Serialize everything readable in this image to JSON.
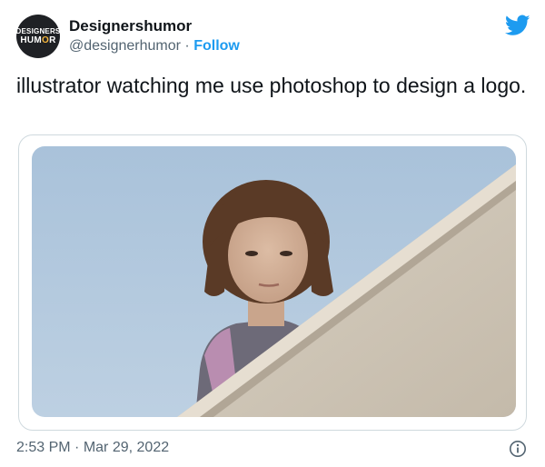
{
  "account": {
    "display_name": "Designershumor",
    "handle": "@designerhumor",
    "separator": "·",
    "follow_label": "Follow",
    "avatar_line1": "DESIGNERS",
    "avatar_line2_a": "HUM",
    "avatar_line2_o": "O",
    "avatar_line2_b": "R"
  },
  "tweet": {
    "text": "illustrator watching me use photoshop to design a logo.",
    "time": "2:53 PM",
    "separator": "·",
    "date": "Mar 29, 2022"
  },
  "icons": {
    "brand": "twitter-bird-icon",
    "info": "info-icon"
  },
  "colors": {
    "accent": "#1d9bf0",
    "secondary_text": "#536471",
    "border": "#cfd9de"
  }
}
